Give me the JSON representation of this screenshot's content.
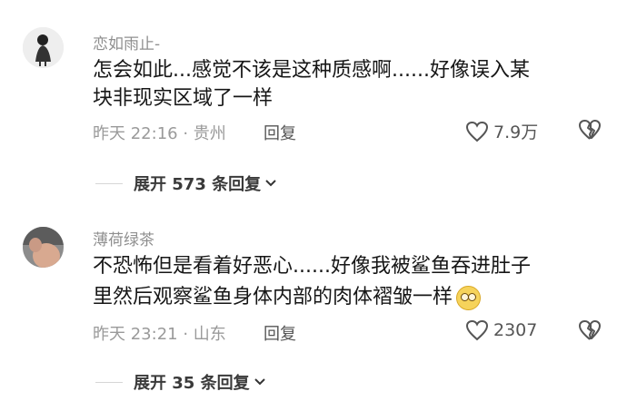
{
  "comments": [
    {
      "username": "恋如雨止-",
      "text_line1": "怎会如此...感觉不该是这种质感啊......好像误入某",
      "text_line2": "块非现实区域了一样",
      "time_location": "昨天 22:16 · 贵州",
      "reply_label": "回复",
      "like_count": "7.9万",
      "expand_label": "展开 573 条回复",
      "avatar_icon": "avatar-silhouette"
    },
    {
      "username": "薄荷绿茶",
      "text_line1": "不恐怖但是看着好恶心......好像我被鲨鱼吞进肚子",
      "text_line2": "里然后观察鲨鱼身体内部的肉体褶皱一样",
      "time_location": "昨天 23:21 · 山东",
      "reply_label": "回复",
      "like_count": "2307",
      "expand_label": "展开 35 条回复",
      "avatar_icon": "avatar-photo"
    }
  ]
}
